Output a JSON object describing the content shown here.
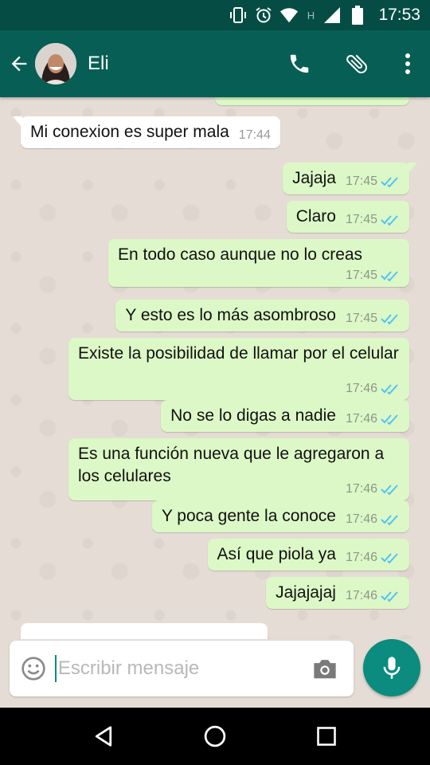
{
  "status_bar": {
    "time": "17:53",
    "network_label": "H",
    "icons": [
      "vibrate-icon",
      "alarm-icon",
      "wifi-icon",
      "signal-icon",
      "battery-icon"
    ]
  },
  "header": {
    "contact_name": "Eli",
    "icons": [
      "back-arrow-icon",
      "avatar",
      "phone-icon",
      "attach-icon",
      "more-vert-icon"
    ],
    "colors": {
      "bar": "#075e54",
      "status": "#054d44"
    }
  },
  "messages": [
    {
      "dir": "in",
      "text": "Mi conexion es super mala",
      "time": "17:44"
    },
    {
      "dir": "out",
      "text": "Jajaja",
      "time": "17:45",
      "read": true
    },
    {
      "dir": "out",
      "text": "Claro",
      "time": "17:45",
      "read": true
    },
    {
      "dir": "out",
      "text": "En todo caso aunque no lo creas",
      "time": "17:45",
      "read": true
    },
    {
      "dir": "out",
      "text": "Y esto es lo más asombroso",
      "time": "17:45",
      "read": true
    },
    {
      "dir": "out",
      "text": "Existe la posibilidad de llamar por el celular",
      "time": "17:46",
      "read": true
    },
    {
      "dir": "out",
      "text": "No se lo digas a nadie",
      "time": "17:46",
      "read": true
    },
    {
      "dir": "out",
      "text": "Es una función nueva que le agregaron a los celulares",
      "time": "17:46",
      "read": true
    },
    {
      "dir": "out",
      "text": "Y poca gente la conoce",
      "time": "17:46",
      "read": true
    },
    {
      "dir": "out",
      "text": "Así que piola ya",
      "time": "17:46",
      "read": true
    },
    {
      "dir": "out",
      "text": "Jajajajaj",
      "time": "17:46",
      "read": true
    }
  ],
  "composer": {
    "placeholder": "Escribir mensaje",
    "icons": [
      "emoji-icon",
      "camera-icon",
      "mic-icon"
    ],
    "accent": "#0b8c7e"
  },
  "colors": {
    "outgoing_bubble": "#dcf8c6",
    "incoming_bubble": "#ffffff",
    "read_ticks": "#4fc3f7",
    "chat_bg": "#e5ddd5"
  },
  "nav_bar": {
    "icons": [
      "back-triangle-icon",
      "home-circle-icon",
      "recents-square-icon"
    ]
  }
}
